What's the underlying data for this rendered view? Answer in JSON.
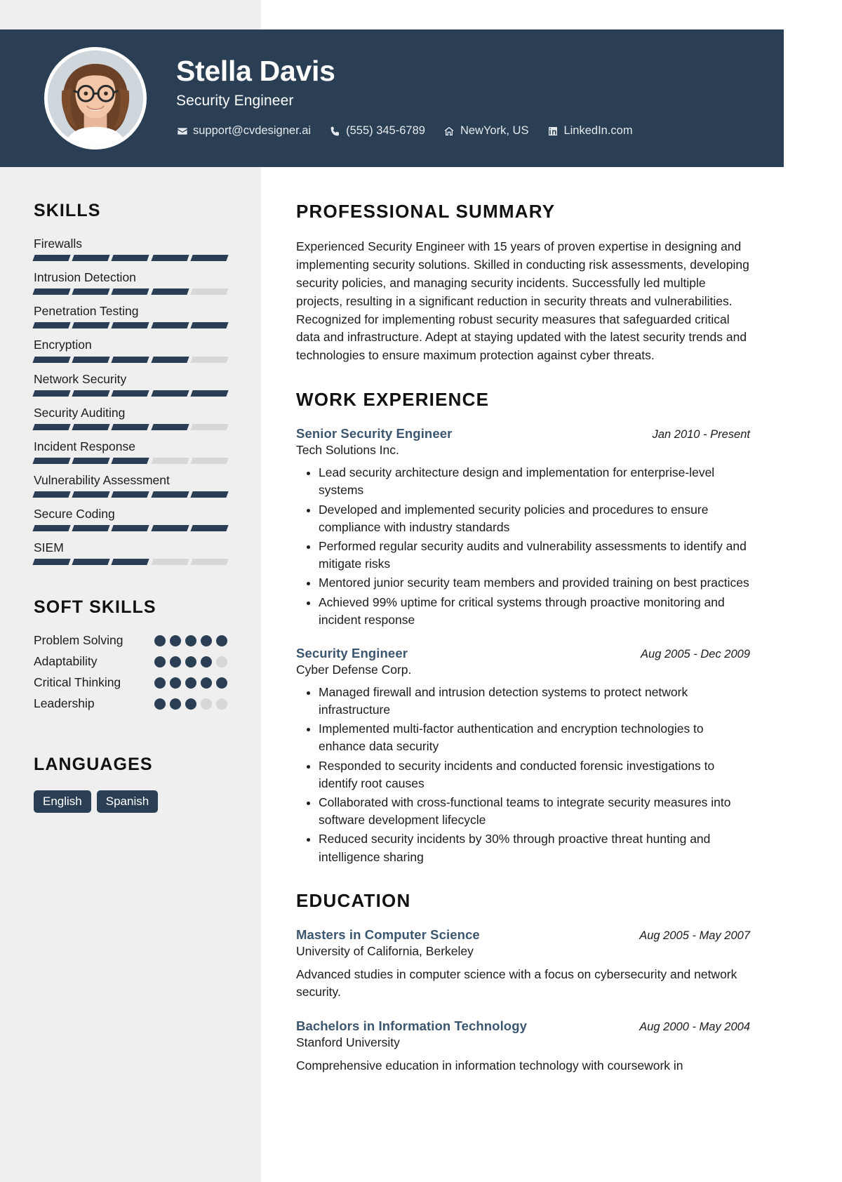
{
  "theme": {
    "navy": "#2a3f54",
    "sidebar_bg": "#efefef",
    "accent_title": "#3c566f",
    "bar_off": "#d7d7d7"
  },
  "header": {
    "full_name": "Stella Davis",
    "job_title": "Security Engineer",
    "avatar_alt": "profile-photo",
    "contacts": [
      {
        "icon": "envelope-icon",
        "text": "support@cvdesigner.ai"
      },
      {
        "icon": "phone-icon",
        "text": "(555) 345-6789"
      },
      {
        "icon": "home-icon",
        "text": "NewYork, US"
      },
      {
        "icon": "linkedin-icon",
        "text": "LinkedIn.com"
      }
    ]
  },
  "sidebar": {
    "skills_heading": "SKILLS",
    "skills": [
      {
        "name": "Firewalls",
        "level": 5,
        "max": 5
      },
      {
        "name": "Intrusion Detection",
        "level": 4,
        "max": 5
      },
      {
        "name": "Penetration Testing",
        "level": 5,
        "max": 5
      },
      {
        "name": "Encryption",
        "level": 4,
        "max": 5
      },
      {
        "name": "Network Security",
        "level": 5,
        "max": 5
      },
      {
        "name": "Security Auditing",
        "level": 4,
        "max": 5
      },
      {
        "name": "Incident Response",
        "level": 3,
        "max": 5
      },
      {
        "name": "Vulnerability Assessment",
        "level": 5,
        "max": 5
      },
      {
        "name": "Secure Coding",
        "level": 5,
        "max": 5
      },
      {
        "name": "SIEM",
        "level": 3,
        "max": 5
      }
    ],
    "soft_skills_heading": "SOFT SKILLS",
    "soft_skills": [
      {
        "name": "Problem Solving",
        "level": 5,
        "max": 5
      },
      {
        "name": "Adaptability",
        "level": 4,
        "max": 5
      },
      {
        "name": "Critical Thinking",
        "level": 5,
        "max": 5
      },
      {
        "name": "Leadership",
        "level": 3,
        "max": 5
      }
    ],
    "languages_heading": "LANGUAGES",
    "languages": [
      "English",
      "Spanish"
    ]
  },
  "main": {
    "summary_heading": "PROFESSIONAL SUMMARY",
    "summary_text": "Experienced Security Engineer with 15 years of proven expertise in designing and implementing security solutions. Skilled in conducting risk assessments, developing security policies, and managing security incidents. Successfully led multiple projects, resulting in a significant reduction in security threats and vulnerabilities. Recognized for implementing robust security measures that safeguarded critical data and infrastructure. Adept at staying updated with the latest security trends and technologies to ensure maximum protection against cyber threats.",
    "work_heading": "WORK EXPERIENCE",
    "work": [
      {
        "title": "Senior Security Engineer",
        "company": "Tech Solutions Inc.",
        "date": "Jan 2010 - Present",
        "bullets": [
          "Lead security architecture design and implementation for enterprise-level systems",
          "Developed and implemented security policies and procedures to ensure compliance with industry standards",
          "Performed regular security audits and vulnerability assessments to identify and mitigate risks",
          "Mentored junior security team members and provided training on best practices",
          "Achieved 99% uptime for critical systems through proactive monitoring and incident response"
        ]
      },
      {
        "title": "Security Engineer",
        "company": "Cyber Defense Corp.",
        "date": "Aug 2005 - Dec 2009",
        "bullets": [
          "Managed firewall and intrusion detection systems to protect network infrastructure",
          "Implemented multi-factor authentication and encryption technologies to enhance data security",
          "Responded to security incidents and conducted forensic investigations to identify root causes",
          "Collaborated with cross-functional teams to integrate security measures into software development lifecycle",
          "Reduced security incidents by 30% through proactive threat hunting and intelligence sharing"
        ]
      }
    ],
    "education_heading": "EDUCATION",
    "education": [
      {
        "degree": "Masters in Computer Science",
        "school": "University of California, Berkeley",
        "date": "Aug 2005 - May 2007",
        "description": "Advanced studies in computer science with a focus on cybersecurity and network security."
      },
      {
        "degree": "Bachelors in Information Technology",
        "school": "Stanford University",
        "date": "Aug 2000 - May 2004",
        "description": "Comprehensive education in information technology with coursework in"
      }
    ]
  }
}
